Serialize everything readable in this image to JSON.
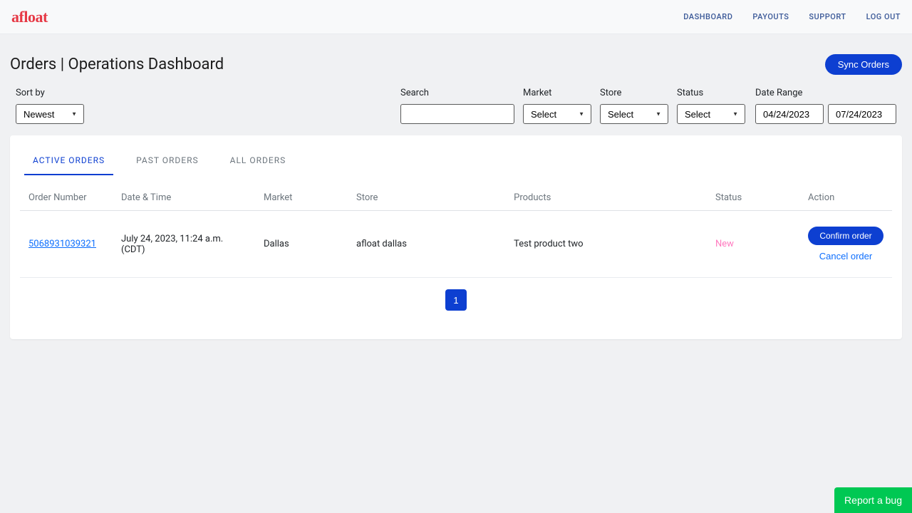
{
  "header": {
    "logo": "afloat",
    "nav": [
      {
        "label": "DASHBOARD"
      },
      {
        "label": "PAYOUTS"
      },
      {
        "label": "SUPPORT"
      },
      {
        "label": "LOG OUT"
      }
    ]
  },
  "page": {
    "title": "Orders | Operations Dashboard",
    "sync_label": "Sync Orders"
  },
  "filters": {
    "sort_by_label": "Sort by",
    "sort_by_value": "Newest",
    "search_label": "Search",
    "search_value": "",
    "market_label": "Market",
    "market_value": "Select",
    "store_label": "Store",
    "store_value": "Select",
    "status_label": "Status",
    "status_value": "Select",
    "date_range_label": "Date Range",
    "date_from": "04/24/2023",
    "date_to": "07/24/2023"
  },
  "tabs": [
    {
      "label": "ACTIVE ORDERS",
      "active": true
    },
    {
      "label": "PAST ORDERS",
      "active": false
    },
    {
      "label": "ALL ORDERS",
      "active": false
    }
  ],
  "table": {
    "columns": [
      "Order Number",
      "Date & Time",
      "Market",
      "Store",
      "Products",
      "Status",
      "Action"
    ],
    "rows": [
      {
        "order_number": "5068931039321",
        "datetime": "July 24, 2023, 11:24 a.m. (CDT)",
        "market": "Dallas",
        "store": "afloat dallas",
        "products": "Test product two",
        "status": "New",
        "confirm_label": "Confirm order",
        "cancel_label": "Cancel order"
      }
    ]
  },
  "pagination": {
    "current": "1"
  },
  "report_bug_label": "Report a bug"
}
